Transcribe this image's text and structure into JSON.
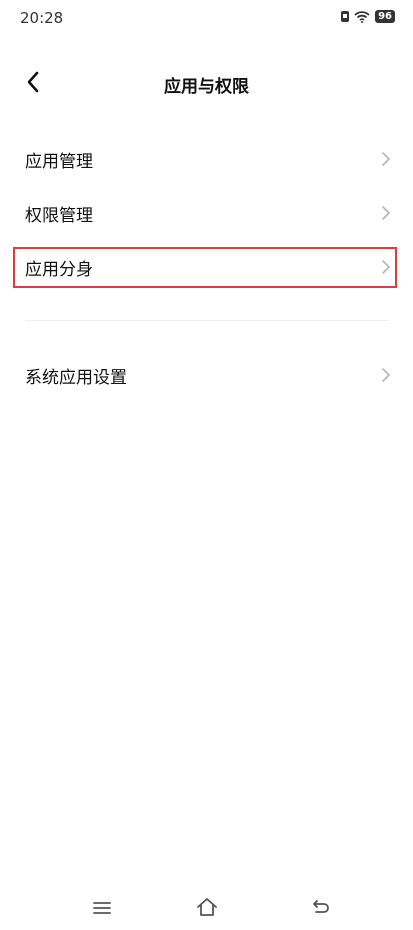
{
  "status_bar": {
    "time": "20:28",
    "battery": "96"
  },
  "header": {
    "title": "应用与权限",
    "back_icon": "chevron-left-icon"
  },
  "menu": {
    "items": [
      {
        "label": "应用管理"
      },
      {
        "label": "权限管理"
      },
      {
        "label": "应用分身"
      }
    ],
    "highlighted_index": 2,
    "highlight_color": "#e03c3c"
  },
  "system_section": {
    "items": [
      {
        "label": "系统应用设置"
      }
    ]
  },
  "nav_bar": {
    "icons": [
      "menu-icon",
      "home-icon",
      "back-icon"
    ]
  }
}
